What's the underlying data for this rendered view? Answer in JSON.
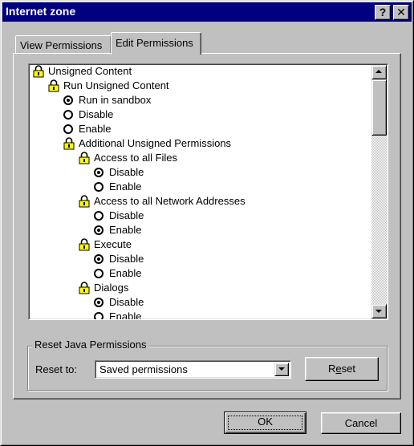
{
  "window": {
    "title": "Internet zone",
    "help_glyph": "?",
    "close_glyph": "✕"
  },
  "tabs": [
    {
      "label": "View Permissions",
      "active": false
    },
    {
      "label": "Edit Permissions",
      "active": true
    }
  ],
  "tree": {
    "items": [
      {
        "label": "Unsigned Content",
        "type": "folder-lock-icon",
        "level": 0
      },
      {
        "label": "Run Unsigned Content",
        "type": "folder-lock-icon",
        "level": 1
      },
      {
        "label": "Run in sandbox",
        "type": "radio",
        "checked": true,
        "level": 2
      },
      {
        "label": "Disable",
        "type": "radio",
        "checked": false,
        "level": 2
      },
      {
        "label": "Enable",
        "type": "radio",
        "checked": false,
        "level": 2
      },
      {
        "label": "Additional Unsigned Permissions",
        "type": "folder-lock-icon",
        "level": 2
      },
      {
        "label": "Access to all Files",
        "type": "folder-lock-icon",
        "level": 3
      },
      {
        "label": "Disable",
        "type": "radio",
        "checked": true,
        "level": 4
      },
      {
        "label": "Enable",
        "type": "radio",
        "checked": false,
        "level": 4
      },
      {
        "label": "Access to all Network Addresses",
        "type": "folder-lock-icon",
        "level": 3
      },
      {
        "label": "Disable",
        "type": "radio",
        "checked": false,
        "level": 4
      },
      {
        "label": "Enable",
        "type": "radio",
        "checked": true,
        "level": 4
      },
      {
        "label": "Execute",
        "type": "folder-lock-icon",
        "level": 3
      },
      {
        "label": "Disable",
        "type": "radio",
        "checked": true,
        "level": 4
      },
      {
        "label": "Enable",
        "type": "radio",
        "checked": false,
        "level": 4
      },
      {
        "label": "Dialogs",
        "type": "folder-lock-icon",
        "level": 3
      },
      {
        "label": "Disable",
        "type": "radio",
        "checked": true,
        "level": 4
      },
      {
        "label": "Enable",
        "type": "radio",
        "checked": false,
        "level": 4
      }
    ]
  },
  "reset_group": {
    "legend": "Reset Java Permissions",
    "reset_to_label": "Reset to:",
    "combo_value": "Saved permissions",
    "reset_button": {
      "first": "R",
      "underlined": "e",
      "rest": "set"
    }
  },
  "footer": {
    "ok_label": "OK",
    "cancel_label": "Cancel"
  },
  "colors": {
    "titlebar": "#000080",
    "face": "#c0c0c0",
    "lock": "#ffff00"
  }
}
